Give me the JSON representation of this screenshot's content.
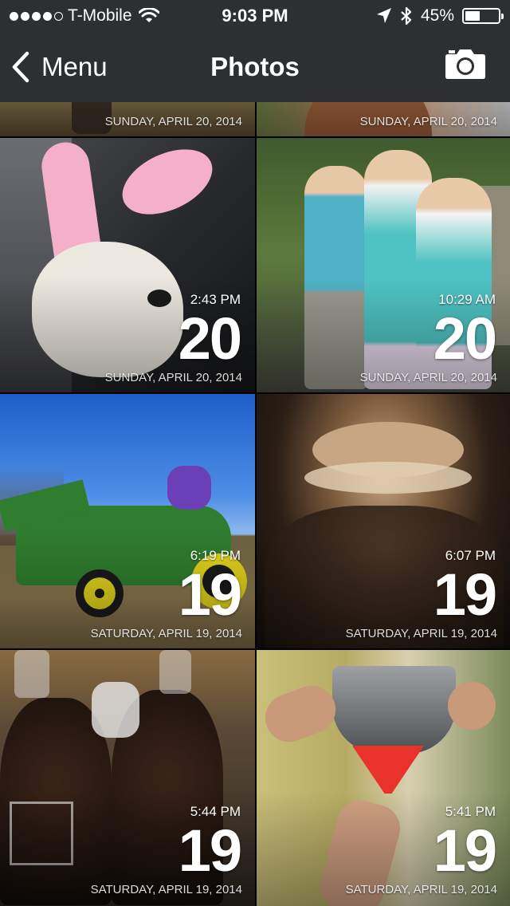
{
  "status_bar": {
    "carrier": "T-Mobile",
    "time": "9:03 PM",
    "battery_percent_label": "45%",
    "battery_level": 0.45,
    "signal_bars_filled": 4,
    "signal_bars_total": 5
  },
  "nav": {
    "back_label": "Menu",
    "title": "Photos"
  },
  "photos": [
    {
      "time": "",
      "day": "",
      "date": "SUNDAY, APRIL 20, 2014"
    },
    {
      "time": "",
      "day": "",
      "date": "SUNDAY, APRIL 20, 2014"
    },
    {
      "time": "2:43 PM",
      "day": "20",
      "date": "SUNDAY, APRIL 20, 2014"
    },
    {
      "time": "10:29 AM",
      "day": "20",
      "date": "SUNDAY, APRIL 20, 2014"
    },
    {
      "time": "6:19 PM",
      "day": "19",
      "date": "SATURDAY, APRIL 19, 2014"
    },
    {
      "time": "6:07 PM",
      "day": "19",
      "date": "SATURDAY, APRIL 19, 2014"
    },
    {
      "time": "5:44 PM",
      "day": "19",
      "date": "SATURDAY, APRIL 19, 2014"
    },
    {
      "time": "5:41 PM",
      "day": "19",
      "date": "SATURDAY, APRIL 19, 2014"
    }
  ],
  "colors": {
    "bar_background": "#2d3033",
    "text": "#ffffff"
  }
}
